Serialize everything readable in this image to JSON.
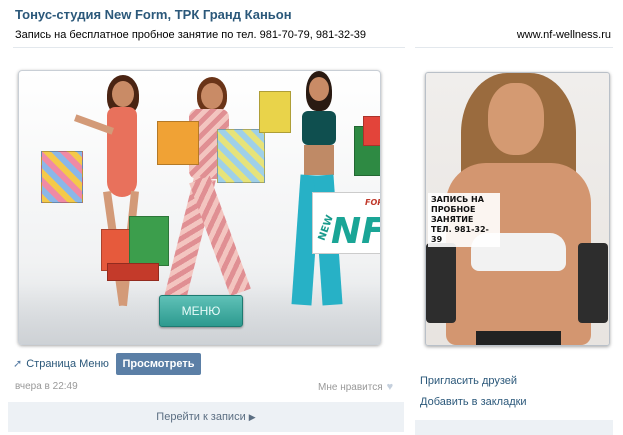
{
  "header": {
    "title": "Тонус-студия New Form, ТРК Гранд Каньон",
    "subtitle": "Запись на бесплатное пробное занятие по тел. 981-70-79, 981-32-39",
    "site": "www.nf-wellness.ru"
  },
  "promo": {
    "menu_label": "МЕНЮ",
    "logo_new": "NEW",
    "logo_nf": "NF",
    "logo_form": "FORM"
  },
  "side_image": {
    "caption": [
      "ЗАПИСЬ НА",
      "ПРОБНОЕ",
      "ЗАНЯТИЕ",
      "ТЕЛ. 981-32-39"
    ]
  },
  "post": {
    "page_link": "Страница Меню",
    "view_button": "Просмотреть",
    "timestamp": "вчера в 22:49",
    "likes_label": "Мне нравится",
    "goto": "Перейти к записи"
  },
  "sidebar": {
    "invite": "Пригласить друзей",
    "bookmark": "Добавить в закладки"
  },
  "colors": {
    "link": "#2b587a",
    "button": "#5b7fa6",
    "menu_button": "#2d9a8f",
    "bar": "#edf1f5"
  }
}
